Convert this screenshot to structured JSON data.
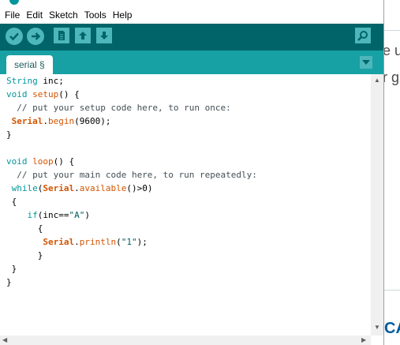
{
  "menu": [
    "File",
    "Edit",
    "Sketch",
    "Tools",
    "Help"
  ],
  "toolbar": {
    "icons": [
      "verify-icon",
      "upload-icon",
      "new-icon",
      "open-icon",
      "save-icon",
      "serial-monitor-icon"
    ]
  },
  "tab": {
    "label": "serial §"
  },
  "code": [
    [
      [
        "kw",
        "String"
      ],
      [
        "",
        " inc;"
      ]
    ],
    [
      [
        "kw",
        "void"
      ],
      [
        "",
        " "
      ],
      [
        "fn",
        "setup"
      ],
      [
        "",
        "() {"
      ]
    ],
    [
      [
        "cm",
        "  // put your setup code here, to run once:"
      ]
    ],
    [
      [
        "",
        " "
      ],
      [
        "obj",
        "Serial"
      ],
      [
        "",
        "."
      ],
      [
        "fn",
        "begin"
      ],
      [
        "",
        "(9600);"
      ]
    ],
    [
      [
        "",
        "}"
      ]
    ],
    [
      [
        "",
        ""
      ]
    ],
    [
      [
        "kw",
        "void"
      ],
      [
        "",
        " "
      ],
      [
        "fn",
        "loop"
      ],
      [
        "",
        "() {"
      ]
    ],
    [
      [
        "cm",
        "  // put your main code here, to run repeatedly:"
      ]
    ],
    [
      [
        "",
        " "
      ],
      [
        "kw",
        "while"
      ],
      [
        "",
        "("
      ],
      [
        "obj",
        "Serial"
      ],
      [
        "",
        "."
      ],
      [
        "fn",
        "available"
      ],
      [
        "",
        "()>0)"
      ]
    ],
    [
      [
        "",
        " {"
      ]
    ],
    [
      [
        "",
        "    "
      ],
      [
        "kw",
        "if"
      ],
      [
        "",
        "(inc=="
      ],
      [
        "str",
        "\"A\""
      ],
      [
        "",
        ")"
      ]
    ],
    [
      [
        "",
        "      {"
      ]
    ],
    [
      [
        "",
        "       "
      ],
      [
        "obj",
        "Serial"
      ],
      [
        "",
        "."
      ],
      [
        "fn",
        "println"
      ],
      [
        "",
        "("
      ],
      [
        "str",
        "\"1\""
      ],
      [
        "",
        ");"
      ]
    ],
    [
      [
        "",
        "      }"
      ]
    ],
    [
      [
        "",
        " }"
      ]
    ],
    [
      [
        "",
        "}"
      ]
    ]
  ],
  "background": {
    "top_text": "e u",
    "second_text": "r g",
    "bottom_text": "CA"
  }
}
